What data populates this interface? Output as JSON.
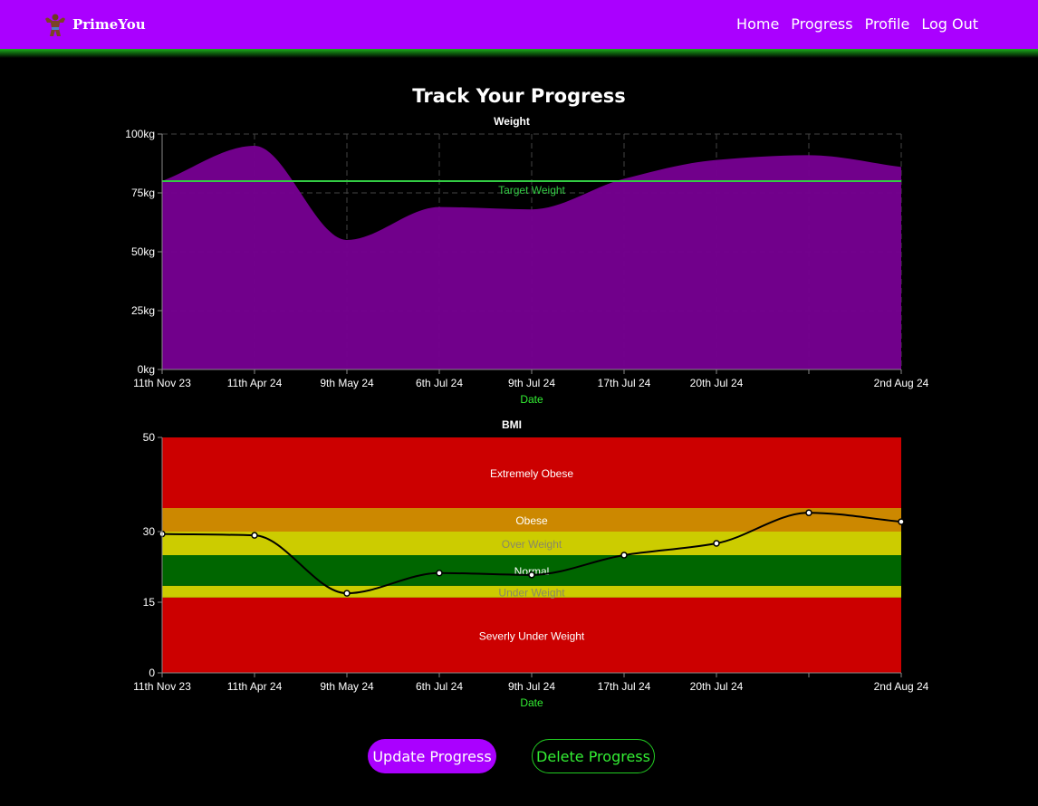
{
  "nav": {
    "brand": "PrimeYou",
    "links": [
      "Home",
      "Progress",
      "Profile",
      "Log Out"
    ]
  },
  "page_title": "Track Your Progress",
  "buttons": {
    "update": "Update Progress",
    "delete": "Delete Progress"
  },
  "colors": {
    "brand_purple": "#aa00ff",
    "accent_green": "#33ee33",
    "area_fill": "#750090",
    "target_line": "#33cc44",
    "band_red": "#cc0000",
    "band_orange": "#cc8800",
    "band_yellow": "#cccc00",
    "band_green": "#006600"
  },
  "chart_data": [
    {
      "type": "area",
      "title": "Weight",
      "xlabel": "Date",
      "ylabel": "",
      "categories": [
        "11th Nov 23",
        "11th Apr 24",
        "9th May 24",
        "6th Jul 24",
        "9th Jul 24",
        "17th Jul 24",
        "20th Jul 24",
        "",
        "2nd Aug 24"
      ],
      "values": [
        80,
        95,
        55,
        69,
        68,
        81,
        89,
        91,
        86
      ],
      "ylim": [
        0,
        100
      ],
      "yticks": [
        "0kg",
        "25kg",
        "50kg",
        "75kg",
        "100kg"
      ],
      "ytick_values": [
        0,
        25,
        50,
        75,
        100
      ],
      "reference_line": {
        "label": "Target Weight",
        "value": 80
      },
      "grid": true
    },
    {
      "type": "line",
      "title": "BMI",
      "xlabel": "Date",
      "ylabel": "",
      "categories": [
        "11th Nov 23",
        "11th Apr 24",
        "9th May 24",
        "6th Jul 24",
        "9th Jul 24",
        "17th Jul 24",
        "20th Jul 24",
        "",
        "2nd Aug 24"
      ],
      "values": [
        29.5,
        29.2,
        16.9,
        21.2,
        20.8,
        25,
        27.5,
        34,
        32.1
      ],
      "ylim": [
        0,
        50
      ],
      "yticks": [
        "0",
        "15",
        "30",
        "50"
      ],
      "ytick_values": [
        0,
        15,
        30,
        50
      ],
      "bands": [
        {
          "label": "Severly Under Weight",
          "from": 0,
          "to": 16,
          "color": "#cc0000",
          "text_color": "#ffffff"
        },
        {
          "label": "Under Weight",
          "from": 16,
          "to": 18.5,
          "color": "#cccc00",
          "text_color": "#888866"
        },
        {
          "label": "Normal",
          "from": 18.5,
          "to": 25,
          "color": "#006600",
          "text_color": "#ffffff"
        },
        {
          "label": "Over Weight",
          "from": 25,
          "to": 30,
          "color": "#cccc00",
          "text_color": "#888866"
        },
        {
          "label": "Obese",
          "from": 30,
          "to": 35,
          "color": "#cc8800",
          "text_color": "#ffffff"
        },
        {
          "label": "Extremely Obese",
          "from": 35,
          "to": 50,
          "color": "#cc0000",
          "text_color": "#ffffff"
        }
      ],
      "grid": false
    }
  ]
}
